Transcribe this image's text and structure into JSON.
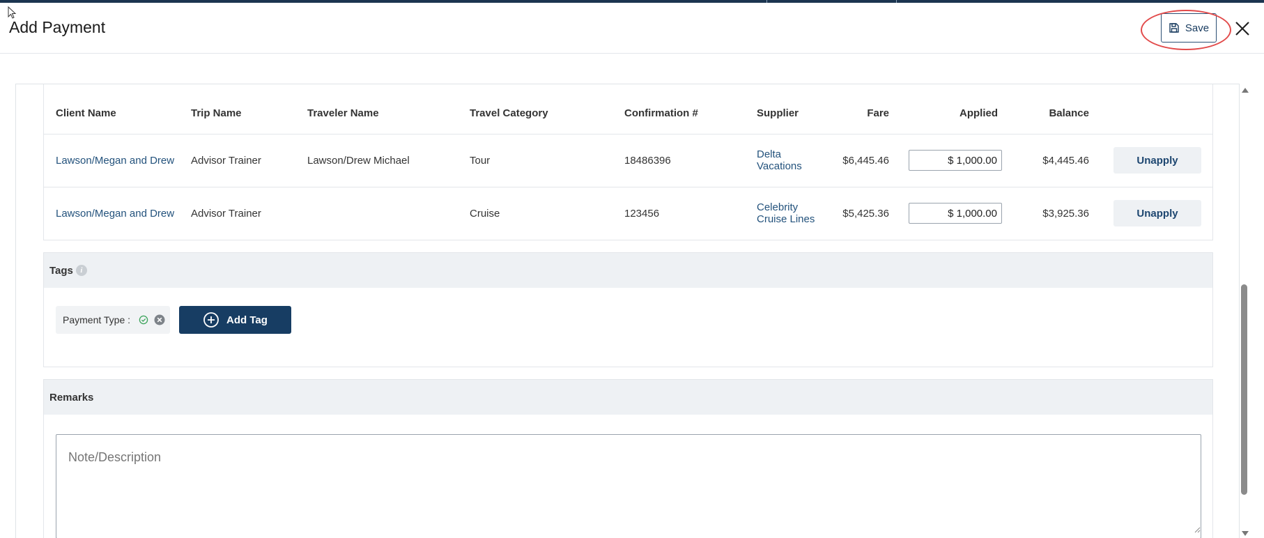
{
  "header": {
    "title": "Add Payment",
    "save_label": "Save"
  },
  "table": {
    "columns": [
      "Client Name",
      "Trip Name",
      "Traveler Name",
      "Travel Category",
      "Confirmation #",
      "Supplier",
      "Fare",
      "Applied",
      "Balance"
    ],
    "rows": [
      {
        "client": "Lawson/Megan and Drew",
        "trip": "Advisor Trainer",
        "traveler": "Lawson/Drew Michael",
        "category": "Tour",
        "confirmation": "18486396",
        "supplier_line1": "Delta",
        "supplier_line2": "Vacations",
        "fare": "$6,445.46",
        "applied": "$ 1,000.00",
        "balance": "$4,445.46",
        "action": "Unapply"
      },
      {
        "client": "Lawson/Megan and Drew",
        "trip": "Advisor Trainer",
        "traveler": "",
        "category": "Cruise",
        "confirmation": "123456",
        "supplier_line1": "Celebrity",
        "supplier_line2": "Cruise Lines",
        "fare": "$5,425.36",
        "applied": "$ 1,000.00",
        "balance": "$3,925.36",
        "action": "Unapply"
      }
    ]
  },
  "tags": {
    "title": "Tags",
    "chip_label": "Payment Type :",
    "add_label": "Add Tag"
  },
  "remarks": {
    "title": "Remarks",
    "placeholder": "Note/Description"
  },
  "icons": {
    "save": "floppy-disk-icon",
    "close": "close-icon",
    "info": "info-icon",
    "check": "check-circle-icon",
    "remove": "remove-circle-icon",
    "add": "plus-circle-icon"
  },
  "colors": {
    "primary": "#173d63",
    "link": "#23527c",
    "highlight": "#e24a4a",
    "section_bg": "#eef1f4"
  }
}
